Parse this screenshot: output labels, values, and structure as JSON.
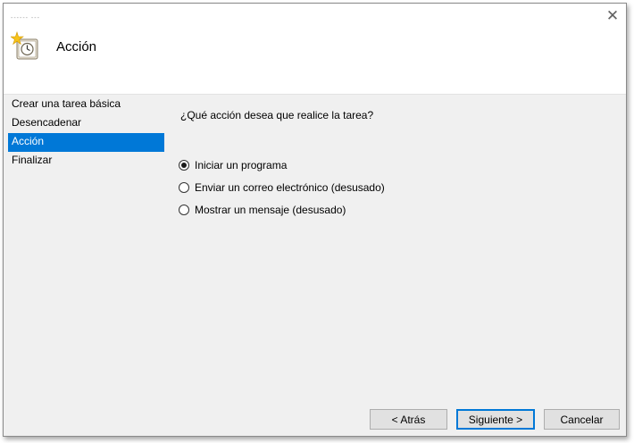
{
  "window": {
    "title_mark": "------ ---",
    "close_glyph": "✕"
  },
  "header": {
    "title": "Acción",
    "icon": "task-scheduler-clock-icon"
  },
  "steps": [
    {
      "label": "Crear una tarea básica",
      "active": false
    },
    {
      "label": "Desencadenar",
      "active": false
    },
    {
      "label": "Acción",
      "active": true
    },
    {
      "label": "Finalizar",
      "active": false
    }
  ],
  "main": {
    "question": "¿Qué acción desea que realice la tarea?",
    "options": [
      {
        "label": "Iniciar un programa",
        "selected": true
      },
      {
        "label": "Enviar un correo electrónico (desusado)",
        "selected": false
      },
      {
        "label": "Mostrar un mensaje (desusado)",
        "selected": false
      }
    ]
  },
  "buttons": {
    "back": "< Atrás",
    "next": "Siguiente >",
    "cancel": "Cancelar"
  },
  "colors": {
    "accent": "#0078d7",
    "panel_bg": "#f0f0f0",
    "header_bg": "#ffffff"
  }
}
